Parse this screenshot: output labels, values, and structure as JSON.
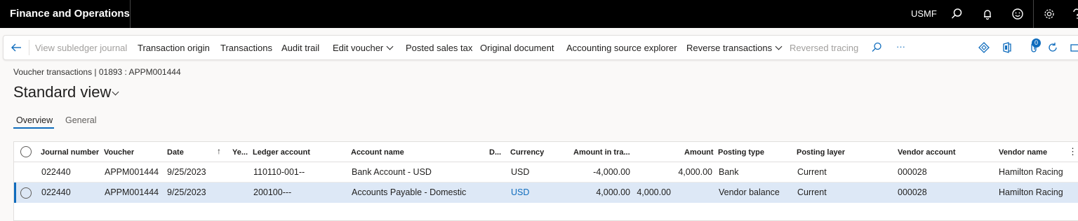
{
  "topbar": {
    "app_title": "Finance and Operations",
    "company": "USMF",
    "icons": [
      "search-icon",
      "bell-icon",
      "smiley-icon",
      "gear-icon",
      "help-icon"
    ]
  },
  "actionbar": {
    "back_icon": "back-arrow-icon",
    "items": [
      {
        "label": "View subledger journal",
        "enabled": false
      },
      {
        "label": "Transaction origin",
        "enabled": true
      },
      {
        "label": "Transactions",
        "enabled": true
      },
      {
        "label": "Audit trail",
        "enabled": true
      },
      {
        "label": "Edit voucher",
        "enabled": true,
        "dropdown": true
      },
      {
        "label": "Posted sales tax",
        "enabled": true
      },
      {
        "label": "Original document",
        "enabled": true
      },
      {
        "label": "Accounting source explorer",
        "enabled": true
      },
      {
        "label": "Reverse transactions",
        "enabled": true,
        "dropdown": true
      },
      {
        "label": "Reversed tracing",
        "enabled": false
      }
    ],
    "more_label": "···",
    "notification_count": "0",
    "accent": "#0f6cbd"
  },
  "breadcrumb": "Voucher transactions  |  01893 : APPM001444",
  "page_title": "Standard view",
  "tabs": [
    {
      "label": "Overview",
      "active": true
    },
    {
      "label": "General",
      "active": false
    }
  ],
  "grid": {
    "columns": [
      "Journal number",
      "Voucher",
      "Date",
      "↑",
      "Ye...",
      "Ledger account",
      "Account name",
      "D...",
      "Currency",
      "Amount in tra...",
      "Amount",
      "Posting type",
      "Posting layer",
      "Vendor account",
      "Vendor name"
    ],
    "rows": [
      {
        "journal": "022440",
        "voucher": "APPM001444",
        "date": "9/25/2023",
        "ledger": "110110-001--",
        "account_name": "Bank Account - USD",
        "currency": "USD",
        "amount_tra": "-4,000.00",
        "amount_extra": "",
        "amount": "4,000.00",
        "posting_type": "Bank",
        "posting_layer": "Current",
        "vendor_account": "000028",
        "vendor_name": "Hamilton Racing",
        "selected": false
      },
      {
        "journal": "022440",
        "voucher": "APPM001444",
        "date": "9/25/2023",
        "ledger": "200100---",
        "account_name": "Accounts Payable - Domestic",
        "currency": "USD",
        "amount_tra": "4,000.00",
        "amount_extra": "4,000.00",
        "amount": "",
        "posting_type": "Vendor balance",
        "posting_layer": "Current",
        "vendor_account": "000028",
        "vendor_name": "Hamilton Racing",
        "selected": true
      }
    ]
  }
}
